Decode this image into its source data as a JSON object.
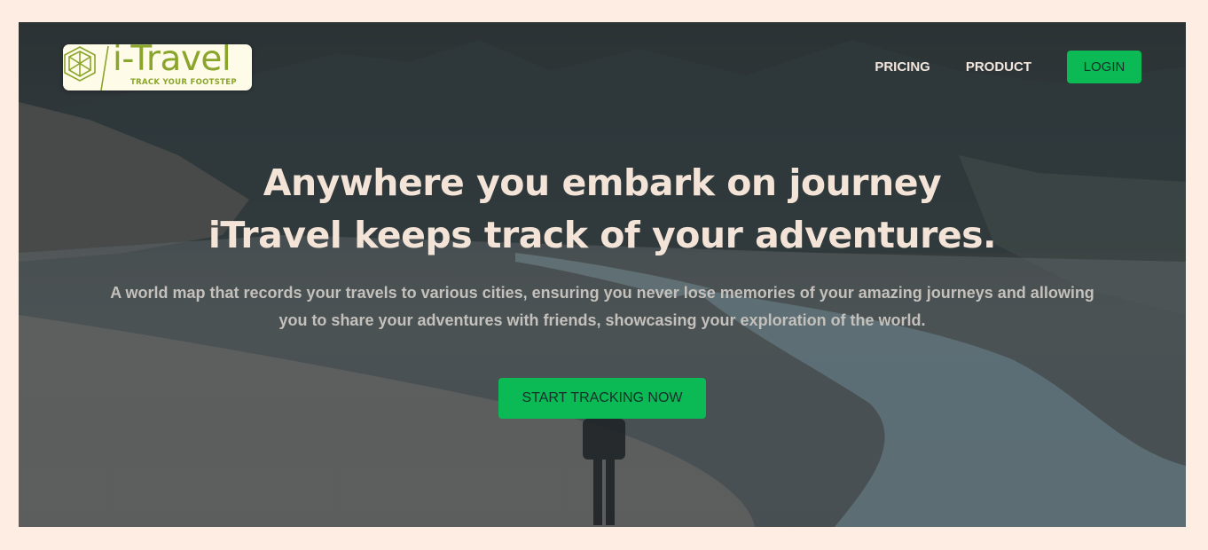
{
  "brand": {
    "name": "i-Travel",
    "tagline": "TRACK YOUR FOOTSTEP"
  },
  "nav": {
    "pricing": "PRICING",
    "product": "PRODUCT",
    "login": "LOGIN"
  },
  "hero": {
    "headline_line1": "Anywhere you embark on journey",
    "headline_line2": "iTravel keeps track of your adventures.",
    "description": "A world map that records your travels to various cities, ensuring you never lose memories of your amazing journeys and allowing you to share your adventures with friends, showcasing your exploration of the world.",
    "cta_label": "START TRACKING NOW"
  },
  "colors": {
    "page_background": "#fdede2",
    "accent_green": "#0bb955",
    "logo_green": "#8aa52b",
    "headline_text": "#f3e4d7"
  },
  "icons": {
    "logo_mark": "hexagon-cube-icon"
  }
}
